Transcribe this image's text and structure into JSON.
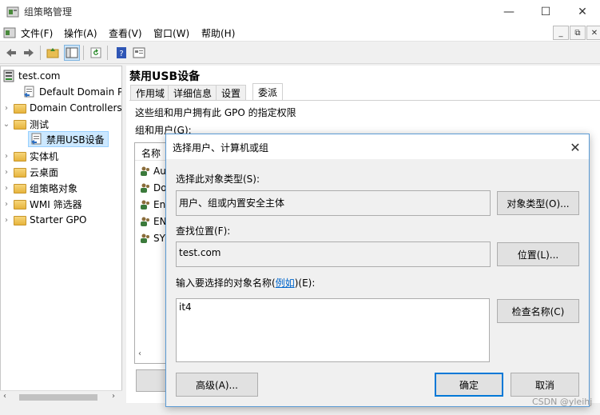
{
  "window": {
    "title": "组策略管理",
    "controls": [
      "—",
      "☐",
      "✕"
    ]
  },
  "menu": {
    "items": [
      "文件(F)",
      "操作(A)",
      "查看(V)",
      "窗口(W)",
      "帮助(H)"
    ],
    "mdi_controls": [
      "_",
      "⧉",
      "✕"
    ]
  },
  "toolbar": {
    "icons": [
      "back-arrow-icon",
      "forward-arrow-icon",
      "up-folder-icon",
      "show-hide-tree-icon",
      "refresh-icon",
      "help-icon",
      "properties-icon"
    ]
  },
  "tree": {
    "items": [
      {
        "label": "test.com",
        "level": 0,
        "expanded": true,
        "icon": "domain-icon"
      },
      {
        "label": "Default Domain Pol",
        "level": 1,
        "icon": "gpo-link-icon"
      },
      {
        "label": "Domain Controllers",
        "level": 1,
        "collapsed": true,
        "icon": "folder-icon"
      },
      {
        "label": "测试",
        "level": 1,
        "expanded": true,
        "icon": "folder-icon"
      },
      {
        "label": "禁用USB设备",
        "level": 2,
        "selected": true,
        "icon": "gpo-link-icon"
      },
      {
        "label": "实体机",
        "level": 1,
        "collapsed": true,
        "icon": "folder-icon"
      },
      {
        "label": "云桌面",
        "level": 1,
        "collapsed": true,
        "icon": "folder-icon"
      },
      {
        "label": "组策略对象",
        "level": 1,
        "collapsed": true,
        "icon": "folder-icon"
      },
      {
        "label": "WMI 筛选器",
        "level": 1,
        "collapsed": true,
        "icon": "folder-icon"
      },
      {
        "label": "Starter GPO",
        "level": 1,
        "collapsed": true,
        "icon": "folder-icon"
      }
    ]
  },
  "details": {
    "heading": "禁用USB设备",
    "tabs": [
      "作用域",
      "详细信息",
      "设置",
      "委派"
    ],
    "active_tab": 3,
    "description": "这些组和用户拥有此 GPO 的指定权限",
    "groups_label": "组和用户(G):",
    "list_header": "名称",
    "list_rows": [
      "Au",
      "Do",
      "En",
      "EN",
      "SY"
    ]
  },
  "dialog": {
    "title": "选择用户、计算机或组",
    "object_type_label": "选择此对象类型(S):",
    "object_type_value": "用户、组或内置安全主体",
    "object_type_button": "对象类型(O)...",
    "location_label": "查找位置(F):",
    "location_value": "test.com",
    "location_button": "位置(L)...",
    "names_label_prefix": "输入要选择的对象名称(",
    "names_label_link": "例如",
    "names_label_suffix": ")(E):",
    "names_value": "it4",
    "check_names_button": "检查名称(C)",
    "advanced_button": "高级(A)...",
    "ok_button": "确定",
    "cancel_button": "取消"
  },
  "watermark": "CSDN @yleihj"
}
